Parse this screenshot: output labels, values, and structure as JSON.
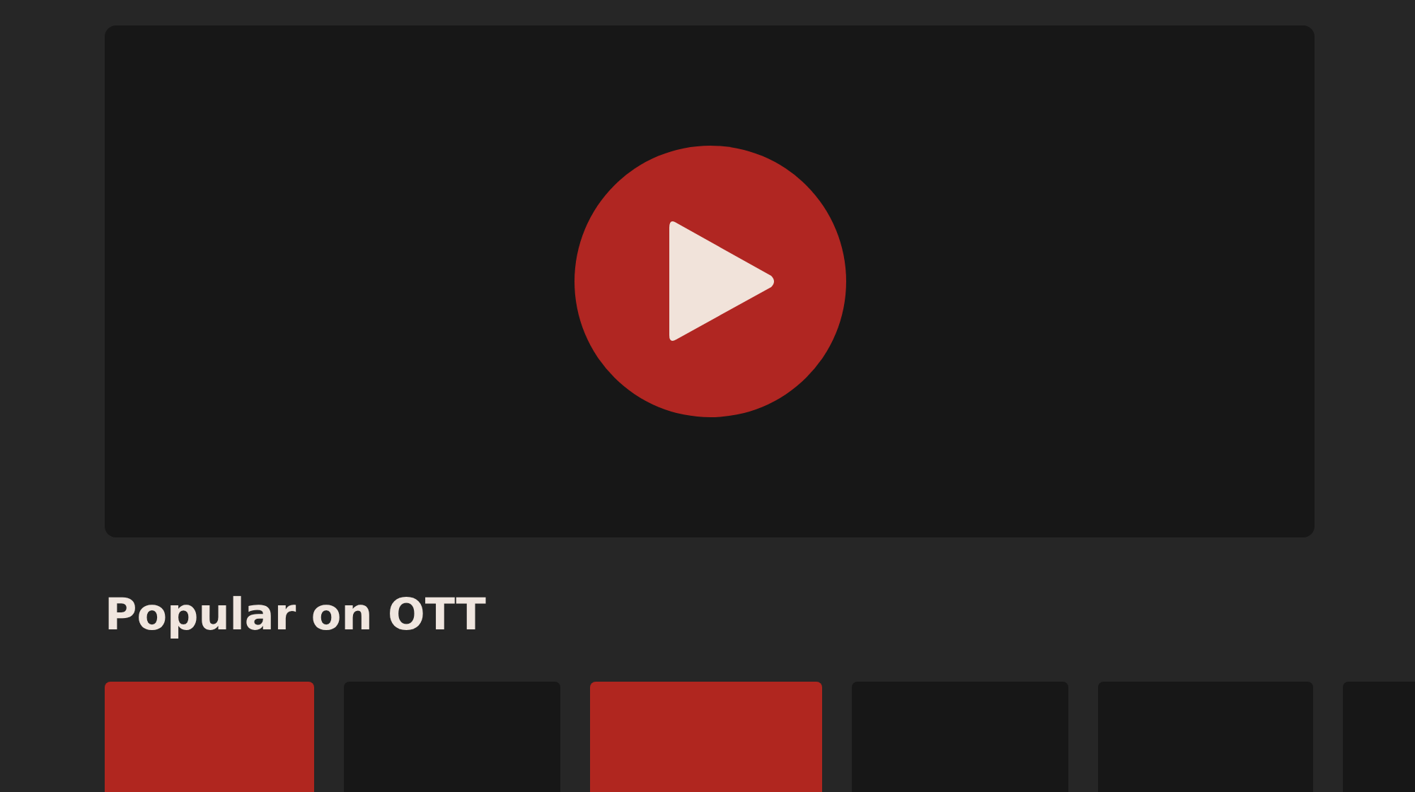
{
  "section_title": "Popular on OTT",
  "tiles": [
    {
      "color": "#b0261f"
    },
    {
      "color": "#171717"
    },
    {
      "color": "#b0261f"
    },
    {
      "color": "#171717"
    },
    {
      "color": "#171717"
    },
    {
      "color": "#171717"
    }
  ]
}
